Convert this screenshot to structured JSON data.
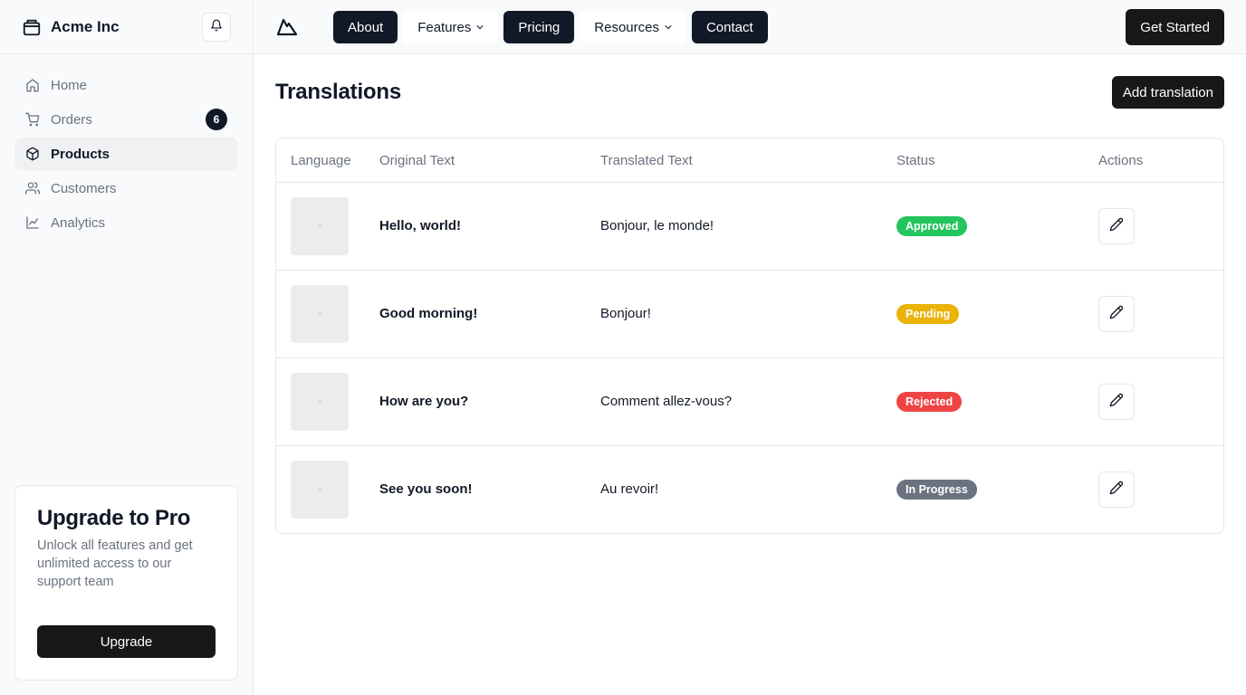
{
  "sidebar": {
    "brand": "Acme Inc",
    "items": [
      {
        "label": "Home",
        "icon": "home-icon"
      },
      {
        "label": "Orders",
        "icon": "cart-icon",
        "badge": "6"
      },
      {
        "label": "Products",
        "icon": "package-icon",
        "active": true
      },
      {
        "label": "Customers",
        "icon": "users-icon"
      },
      {
        "label": "Analytics",
        "icon": "chart-icon"
      }
    ],
    "upgrade": {
      "title": "Upgrade to Pro",
      "description": "Unlock all features and get unlimited access to our support team",
      "button": "Upgrade"
    }
  },
  "topbar": {
    "menu": [
      {
        "label": "About",
        "style": "dark"
      },
      {
        "label": "Features",
        "style": "light",
        "dropdown": true
      },
      {
        "label": "Pricing",
        "style": "dark"
      },
      {
        "label": "Resources",
        "style": "light",
        "dropdown": true
      },
      {
        "label": "Contact",
        "style": "dark"
      }
    ],
    "cta": "Get Started"
  },
  "main": {
    "title": "Translations",
    "add_button": "Add translation",
    "columns": [
      "Language",
      "Original Text",
      "Translated Text",
      "Status",
      "Actions"
    ],
    "rows": [
      {
        "original": "Hello, world!",
        "translated": "Bonjour, le monde!",
        "status": "Approved",
        "status_color": "#22c55e"
      },
      {
        "original": "Good morning!",
        "translated": "Bonjour!",
        "status": "Pending",
        "status_color": "#eab308"
      },
      {
        "original": "How are you?",
        "translated": "Comment allez-vous?",
        "status": "Rejected",
        "status_color": "#ef4444"
      },
      {
        "original": "See you soon!",
        "translated": "Au revoir!",
        "status": "In Progress",
        "status_color": "#6b7280"
      }
    ]
  },
  "colors": {
    "primary": "#18181b",
    "nav_dark": "#111827",
    "muted": "#6b7280",
    "border": "#e5e7eb"
  }
}
